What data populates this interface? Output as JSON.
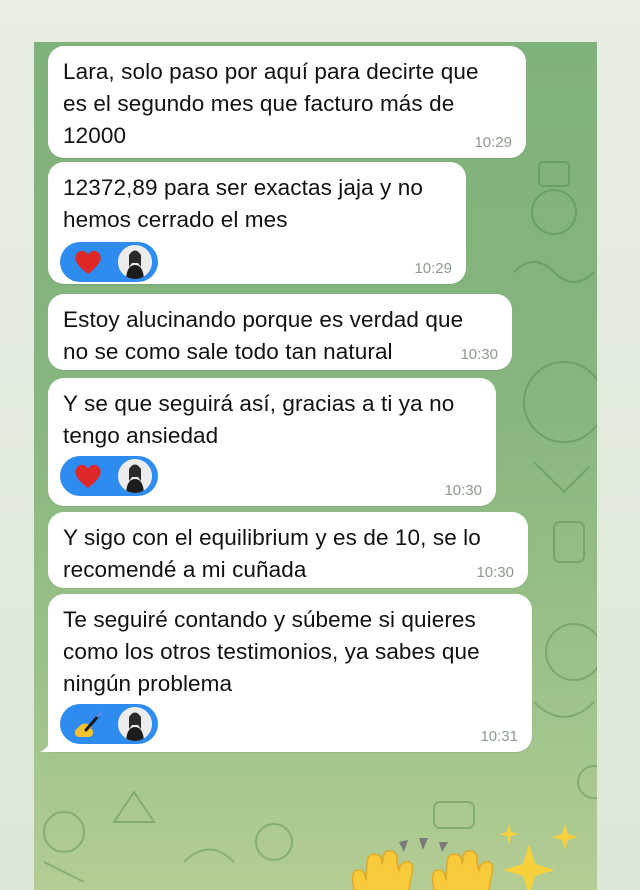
{
  "messages": [
    {
      "text": "Lara, solo paso por aquí para decirte que\nes el segundo mes que facturo más de\n12000",
      "time": "10:29"
    },
    {
      "text": "12372,89 para ser exactas jaja y no\nhemos cerrado el mes",
      "time": "10:29",
      "reaction": "red-heart"
    },
    {
      "text": "Estoy alucinando porque es verdad que\nno se como sale todo tan natural",
      "time": "10:30"
    },
    {
      "text": "Y se que seguirá así, gracias a ti ya no\ntengo ansiedad",
      "time": "10:30",
      "reaction": "red-heart"
    },
    {
      "text": "Y sigo con el equilibrium y es de 10, se lo\nrecomendé a mi cuñada",
      "time": "10:30"
    },
    {
      "text": "Te seguiré contando y súbeme si quieres\ncomo los otros testimonios, ya sabes que\nningún problema",
      "time": "10:31",
      "reaction": "writing-hand"
    }
  ],
  "sticker": {
    "name": "raising-hands-sparkles"
  },
  "colors": {
    "reaction_bg": "#2e8cf0",
    "bubble_bg": "#ffffff",
    "timestamp": "#8d9a8c"
  }
}
